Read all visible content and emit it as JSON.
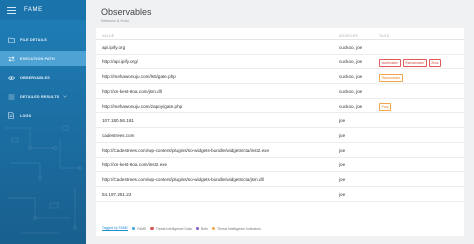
{
  "app": {
    "name": "FAME"
  },
  "colors": {
    "sidebar": "#1b6da1",
    "active": "#4fa2d4",
    "red_tag": "#d54a4a",
    "orange_tag": "#e08b28"
  },
  "sidebar": {
    "items": [
      {
        "label": "FILE DETAILS",
        "icon": "folder-icon",
        "active": false
      },
      {
        "label": "EXECUTION PATH",
        "icon": "exchange-icon",
        "active": true
      },
      {
        "label": "OBSERVABLES",
        "icon": "eye-icon",
        "active": false
      },
      {
        "label": "DETAILED RESULTS",
        "icon": "list-icon",
        "active": false
      },
      {
        "label": "LOGS",
        "icon": "document-icon",
        "active": false
      }
    ]
  },
  "page": {
    "title": "Observables",
    "subtitle": "Network & Host"
  },
  "table": {
    "headers": {
      "value": "VALUE",
      "sources": "SOURCES",
      "tags": "TAGS"
    },
    "rows": [
      {
        "value": "api.ipify.org",
        "sources": "cuckoo, joe",
        "tags": []
      },
      {
        "value": "http://api.ipify.org/",
        "sources": "cuckoo, joe",
        "tags": [
          {
            "label": "downloader",
            "color": "red"
          },
          {
            "label": "Ransomware",
            "color": "red"
          },
          {
            "label": "Zeus",
            "color": "red"
          }
        ]
      },
      {
        "value": "http://mehawonuju.com/ls5/gate.php",
        "sources": "cuckoo, joe",
        "tags": [
          {
            "label": "Ransomware",
            "color": "orange"
          }
        ]
      },
      {
        "value": "http://xn-kest-8oa.com/jsm.dll",
        "sources": "cuckoo, joe",
        "tags": []
      },
      {
        "value": "http://mehawonuju.com/zapoy/gate.php",
        "sources": "cuckoo, joe",
        "tags": [
          {
            "label": "Pony",
            "color": "orange"
          }
        ]
      },
      {
        "value": "107.180.56.181",
        "sources": "joe",
        "tags": []
      },
      {
        "value": "cadestrees.com",
        "sources": "joe",
        "tags": []
      },
      {
        "value": "http://Cadestrees.com/wp-content/plugins/so-widgets-bundle/widgets/cta/inst2.exe",
        "sources": "joe",
        "tags": []
      },
      {
        "value": "http://xn-kest-8oa.com/inst2.exe",
        "sources": "joe",
        "tags": []
      },
      {
        "value": "http://Cadestrees.com/wp-content/plugins/so-widgets-bundle/widgets/cta/jsm.dll",
        "sources": "joe",
        "tags": []
      },
      {
        "value": "54.197.251.22",
        "sources": "joe",
        "tags": []
      }
    ]
  },
  "legend": {
    "tagged": "Tagged by FAME",
    "items": [
      {
        "label": "FAME",
        "color": "#3da5e0"
      },
      {
        "label": "Threat Intelligence Data",
        "color": "#e05656"
      },
      {
        "label": "Both",
        "color": "#7d5bc9"
      },
      {
        "label": "Threat Intelligence Indicators",
        "color": "#f0a64b"
      }
    ]
  }
}
